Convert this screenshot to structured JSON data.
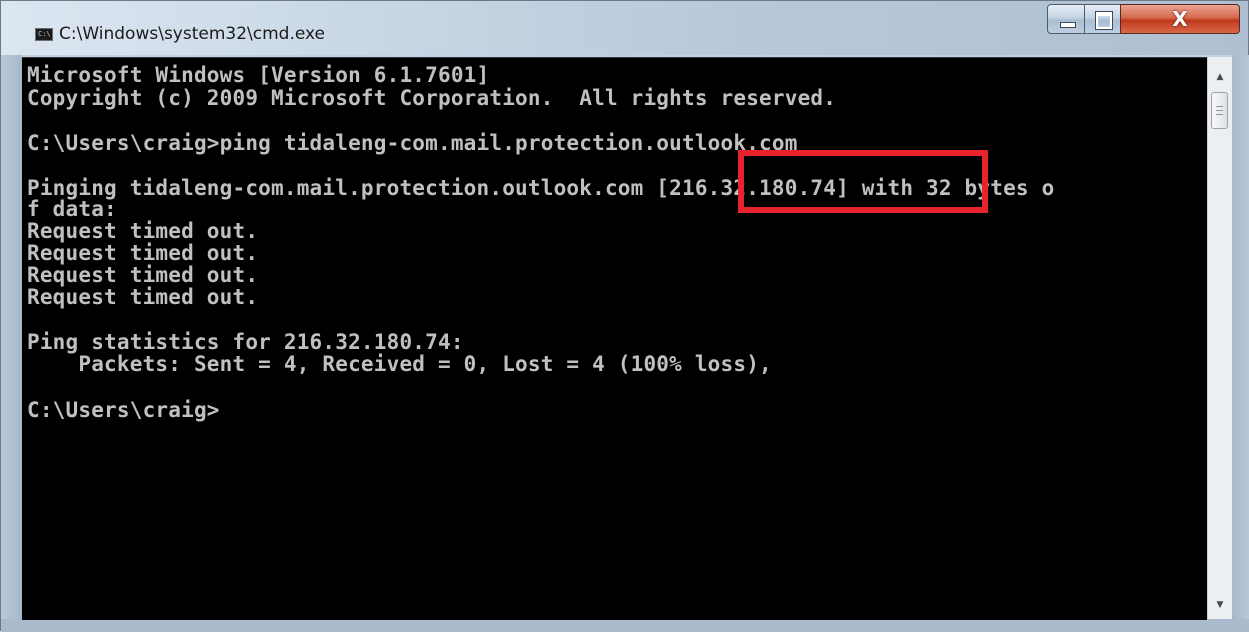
{
  "window": {
    "title": "C:\\Windows\\system32\\cmd.exe",
    "icon": "cmd-icon",
    "icon_label": "C:\\",
    "controls": {
      "minimize": "minimize-icon",
      "maximize": "maximize-icon",
      "close": "close-icon",
      "close_glyph": "X"
    }
  },
  "console": {
    "lines": [
      "Microsoft Windows [Version 6.1.7601]",
      "Copyright (c) 2009 Microsoft Corporation.  All rights reserved.",
      "",
      "C:\\Users\\craig>ping tidaleng-com.mail.protection.outlook.com",
      "",
      "Pinging tidaleng-com.mail.protection.outlook.com [216.32.180.74] with 32 bytes o",
      "f data:",
      "Request timed out.",
      "Request timed out.",
      "Request timed out.",
      "Request timed out.",
      "",
      "Ping statistics for 216.32.180.74:",
      "    Packets: Sent = 4, Received = 0, Lost = 4 (100% loss),",
      "",
      "C:\\Users\\craig>"
    ],
    "highlighted_text": "[216.32.180.74]",
    "text_color": "#c0c0c0",
    "background_color": "#000000",
    "highlight_color": "#e8232b"
  },
  "scrollbar": {
    "up_arrow": "▲",
    "down_arrow": "▼"
  }
}
